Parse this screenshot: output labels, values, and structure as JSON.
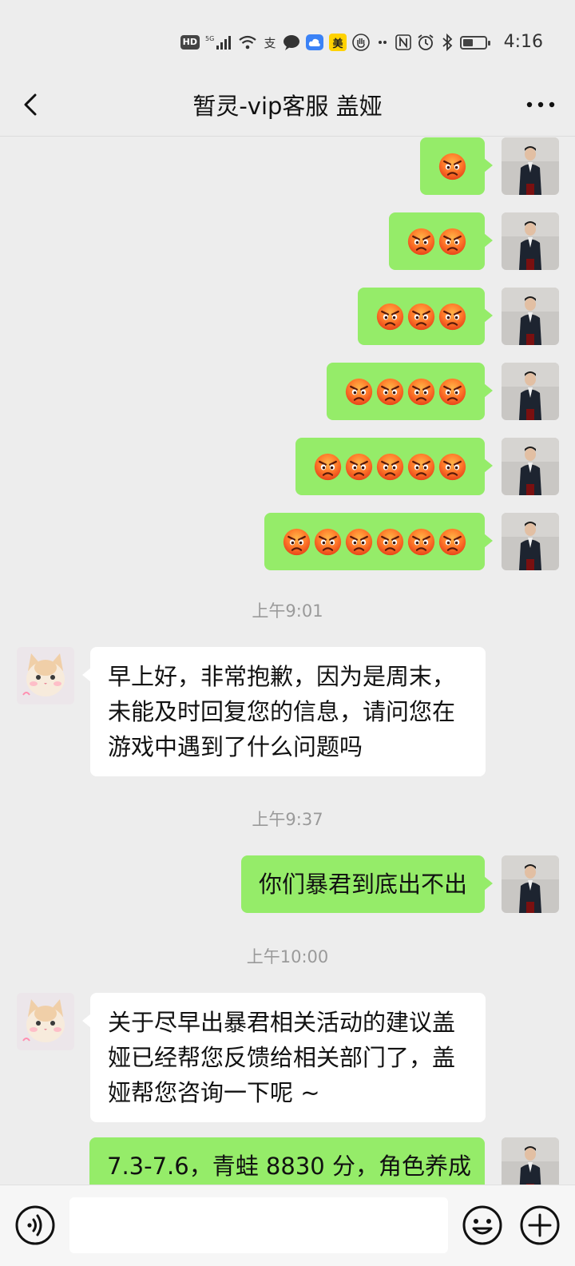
{
  "status_bar": {
    "hd_label": "HD",
    "signal_label": "5G",
    "alipay_label": "支",
    "meituan_label": "美",
    "time": "4:16",
    "battery_level": 0.45
  },
  "header": {
    "title": "暂灵-vip客服 盖娅"
  },
  "chat": {
    "emoji_rows": [
      1,
      2,
      3,
      4,
      5,
      6
    ],
    "timestamps": [
      "上午9:01",
      "上午9:37",
      "上午10:00"
    ],
    "messages": {
      "agent_1": "早上好，非常抱歉，因为是周末，未能及时回复您的信息，请问您在游戏中遇到了什么问题吗",
      "user_1": "你们暴君到底出不出",
      "agent_2": "关于尽早出暴君相关活动的建议盖娅已经帮您反馈给相关部门了，盖娅帮您咨询一下呢 ~",
      "user_2": "7.3-7.6，青蛙 8830 分，角色养成"
    }
  },
  "colors": {
    "background": "#ededed",
    "my_bubble": "#95ec69",
    "other_bubble": "#ffffff",
    "timestamp": "#9a9a9a"
  },
  "icons": {
    "back": "chevron-left-icon",
    "more": "more-dots-icon",
    "voice": "voice-icon",
    "emoji": "smiley-icon",
    "plus": "plus-icon",
    "angry_emoji": "angry-face-icon"
  }
}
